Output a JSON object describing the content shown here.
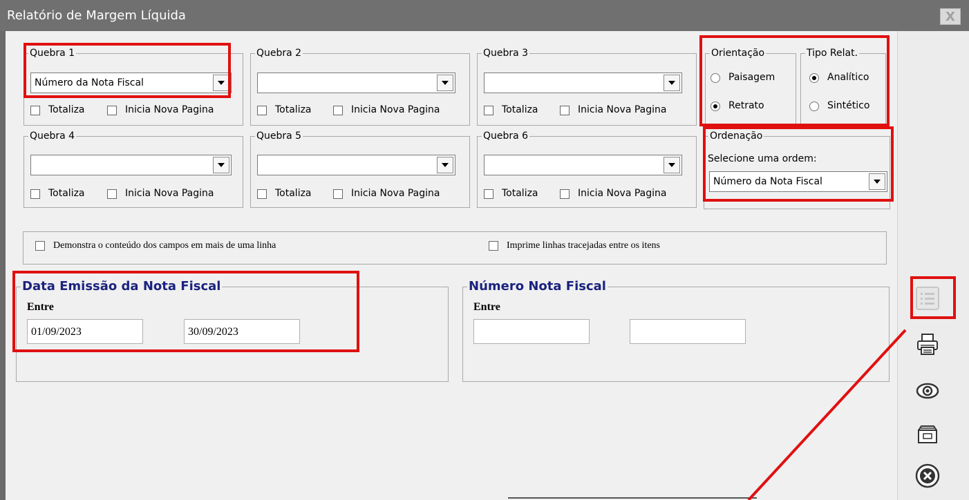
{
  "window": {
    "title": "Relatório de Margem Líquida",
    "close_label": "X"
  },
  "quebras": [
    {
      "legend": "Quebra 1",
      "value": "Número da Nota Fiscal",
      "totaliza": "Totaliza",
      "inicia": "Inicia Nova Pagina"
    },
    {
      "legend": "Quebra 2",
      "value": "",
      "totaliza": "Totaliza",
      "inicia": "Inicia Nova Pagina"
    },
    {
      "legend": "Quebra 3",
      "value": "",
      "totaliza": "Totaliza",
      "inicia": "Inicia Nova Pagina"
    },
    {
      "legend": "Quebra 4",
      "value": "",
      "totaliza": "Totaliza",
      "inicia": "Inicia Nova Pagina"
    },
    {
      "legend": "Quebra 5",
      "value": "",
      "totaliza": "Totaliza",
      "inicia": "Inicia Nova Pagina"
    },
    {
      "legend": "Quebra 6",
      "value": "",
      "totaliza": "Totaliza",
      "inicia": "Inicia Nova Pagina"
    }
  ],
  "orientacao": {
    "legend": "Orientação",
    "paisagem": "Paisagem",
    "retrato": "Retrato",
    "selected": "Retrato"
  },
  "tipo": {
    "legend": "Tipo Relat.",
    "analitico": "Analítico",
    "sintetico": "Sintético",
    "selected": "Analítico"
  },
  "ordenacao": {
    "legend": "Ordenação",
    "prompt": "Selecione uma ordem:",
    "value": "Número da Nota Fiscal"
  },
  "options": {
    "multiline": "Demonstra o conteúdo dos campos em mais de uma linha",
    "dashed": "Imprime linhas tracejadas entre os itens"
  },
  "data_emissao": {
    "legend": "Data Emissão da Nota Fiscal",
    "entre": "Entre",
    "from": "01/09/2023",
    "to": "30/09/2023"
  },
  "numero_nota": {
    "legend": "Número Nota Fiscal",
    "entre": "Entre",
    "from": "",
    "to": ""
  },
  "colors": {
    "title_bar": "#707070",
    "highlight": "#e01010",
    "legend_blue": "#1a237e"
  },
  "sidebar": {
    "icons": [
      "list-icon",
      "printer-icon",
      "eye-icon",
      "folder-icon",
      "cancel-icon"
    ]
  }
}
